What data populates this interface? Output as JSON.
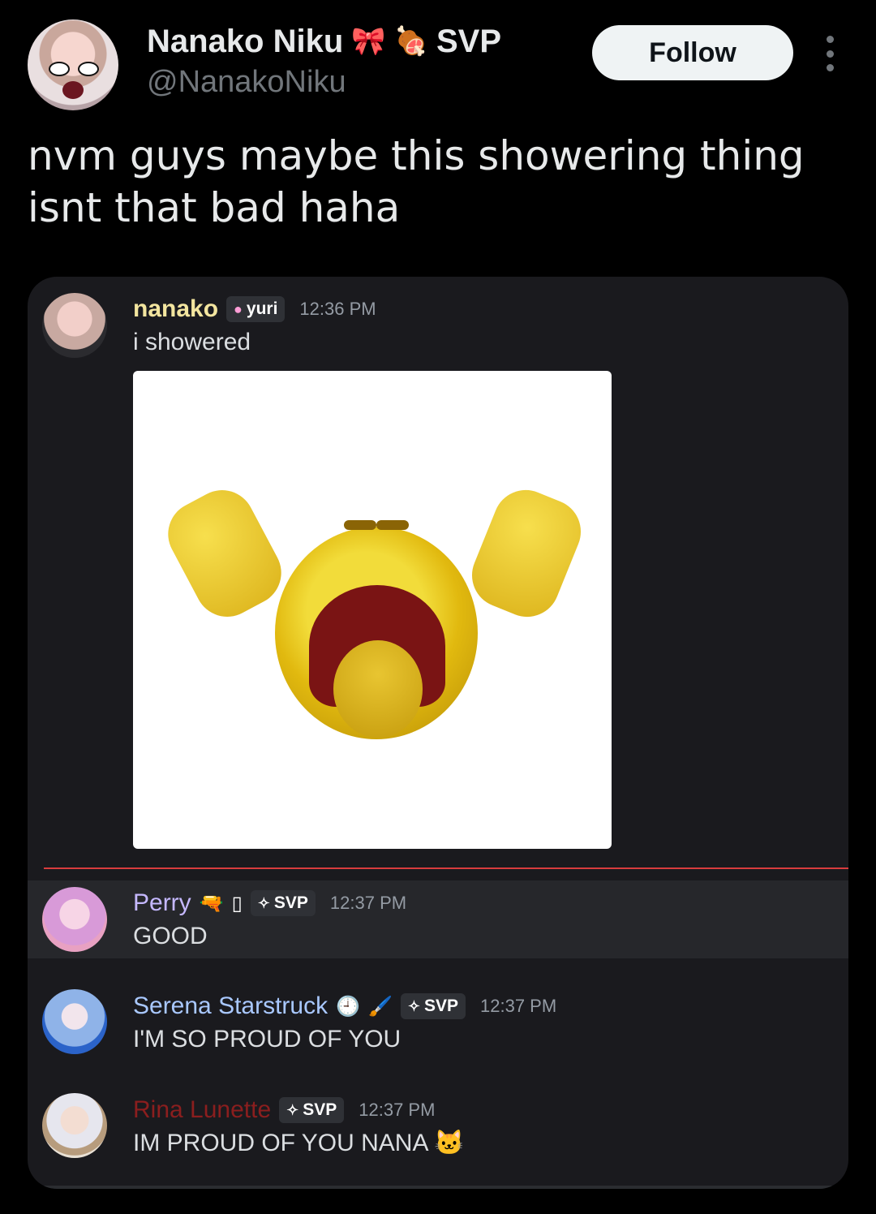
{
  "tweet": {
    "display_name": "Nanako Niku",
    "name_emojis": [
      "🎀",
      "🍖"
    ],
    "name_suffix": "SVP",
    "handle": "@NanakoNiku",
    "follow_label": "Follow",
    "text": "nvm guys maybe this showering thing isnt that bad haha"
  },
  "discord": {
    "messages": [
      {
        "username": "nanako",
        "username_color": "#f3e59f",
        "tag_icon": "heart-icon",
        "tag_label": "yuri",
        "time": "12:36 PM",
        "text": "i showered"
      },
      {
        "username": "Perry",
        "username_color": "#c5b8ff",
        "badge_glyph": "🔫",
        "badge_box": "▯",
        "tag_icon": "diamond-icon",
        "tag_label": "SVP",
        "time": "12:37 PM",
        "text": "GOOD"
      },
      {
        "username": "Serena Starstruck",
        "username_color": "#a9c8ff",
        "badge_glyph": "🕘",
        "badge_glyph2": "🖌️",
        "tag_icon": "diamond-icon",
        "tag_label": "SVP",
        "time": "12:37 PM",
        "text": "I'M SO PROUD OF YOU"
      },
      {
        "username": "Rina Lunette",
        "username_color": "#8b1e1e",
        "tag_icon": "diamond-icon",
        "tag_label": "SVP",
        "time": "12:37 PM",
        "text": "IM PROUD OF YOU NANA",
        "trailing_emoji": "🐱"
      }
    ]
  },
  "colors": {
    "background": "#000000",
    "card_background": "#1a1a1e",
    "divider": "#d83c3e"
  }
}
